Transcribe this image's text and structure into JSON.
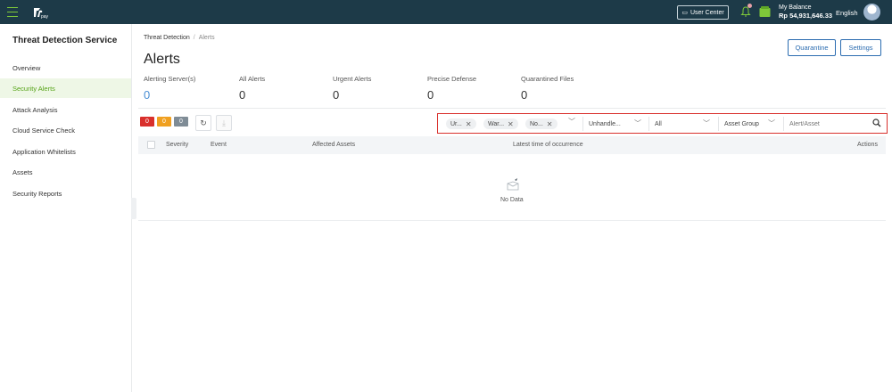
{
  "topbar": {
    "user_center": "User Center",
    "balance_label": "My Balance",
    "balance_value": "Rp 54,931,646.33",
    "language": "English",
    "icons": [
      "menu-icon",
      "logo",
      "monitor-icon",
      "bell-icon",
      "wallet-icon",
      "avatar"
    ],
    "accent": "#7ec83a",
    "background": "#1d3a48"
  },
  "sidebar": {
    "title": "Threat Detection Service",
    "items": [
      {
        "label": "Overview"
      },
      {
        "label": "Security Alerts",
        "active": true
      },
      {
        "label": "Attack Analysis"
      },
      {
        "label": "Cloud Service Check"
      },
      {
        "label": "Application Whitelists"
      },
      {
        "label": "Assets"
      },
      {
        "label": "Security Reports"
      }
    ],
    "active_color": "#56a318"
  },
  "main": {
    "breadcrumb": [
      "Threat Detection",
      "Alerts"
    ],
    "title": "Alerts",
    "buttons": {
      "quarantine": "Quarantine",
      "settings": "Settings"
    },
    "stats": [
      {
        "label": "Alerting Server(s)",
        "value": "0"
      },
      {
        "label": "All Alerts",
        "value": "0"
      },
      {
        "label": "Urgent Alerts",
        "value": "0"
      },
      {
        "label": "Precise Defense",
        "value": "0"
      },
      {
        "label": "Quarantined Files",
        "value": "0"
      }
    ],
    "severity_counts": [
      {
        "value": "0",
        "color": "#d9302c"
      },
      {
        "value": "0",
        "color": "#f0a020"
      },
      {
        "value": "0",
        "color": "#7f8c96"
      }
    ],
    "filters": {
      "chips": [
        "Ur...",
        "War...",
        "No..."
      ],
      "status": "Unhandle...",
      "type": "All",
      "asset_group": "Asset Group",
      "search_placeholder": "Alert/Asset"
    },
    "table": {
      "columns": [
        "Severity",
        "Event",
        "Affected Assets",
        "Latest time of occurrence",
        "Actions"
      ],
      "empty_text": "No Data"
    }
  }
}
